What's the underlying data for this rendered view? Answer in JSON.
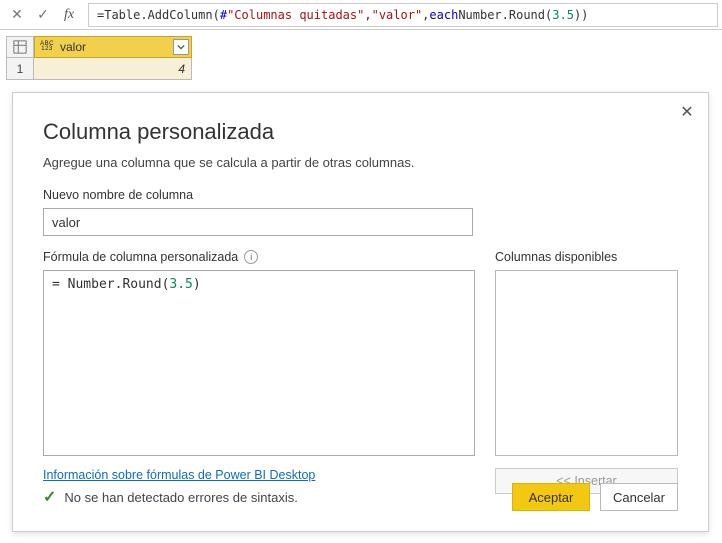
{
  "formula_bar": {
    "eq": "= ",
    "fn1": "Table.AddColumn",
    "open": "(",
    "arg1_hash": "#",
    "arg1_str": "\"Columnas quitadas\"",
    "comma1": ", ",
    "arg2_str": "\"valor\"",
    "comma2": ", ",
    "kw_each": "each",
    "sp": " ",
    "fn2": "Number.Round",
    "open2": "(",
    "num": "3.5",
    "close2": ")",
    "close1": ")"
  },
  "grid": {
    "column_name": "valor",
    "row1_num": "1",
    "row1_val": "4"
  },
  "dialog": {
    "title": "Columna personalizada",
    "subtitle": "Agregue una columna que se calcula a partir de otras columnas.",
    "new_col_label": "Nuevo nombre de columna",
    "new_col_value": "valor",
    "formula_label": "Fórmula de columna personalizada",
    "formula_eq": "= ",
    "formula_fn": "Number.Round",
    "formula_open": "(",
    "formula_num": "3.5",
    "formula_close": ")",
    "avail_label": "Columnas disponibles",
    "insert_label": "<< Insertar",
    "link_text": "Información sobre fórmulas de Power BI Desktop",
    "status_text": "No se han detectado errores de sintaxis.",
    "ok_label": "Aceptar",
    "cancel_label": "Cancelar"
  }
}
